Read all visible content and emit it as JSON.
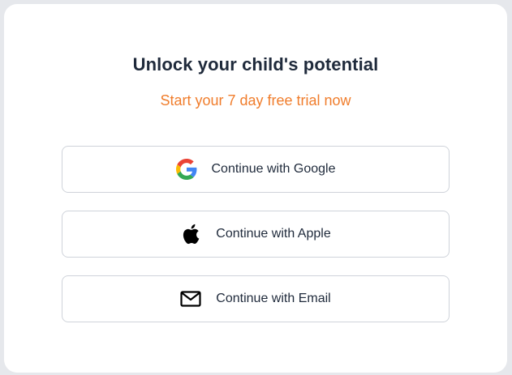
{
  "header": {
    "title": "Unlock your child's potential",
    "subtitle": "Start your 7 day free trial now"
  },
  "colors": {
    "subtitle": "#f07d2c",
    "title": "#1f2a3b",
    "border": "#cfd3da"
  },
  "buttons": [
    {
      "label": "Continue with Google",
      "icon": "google-icon"
    },
    {
      "label": "Continue with Apple",
      "icon": "apple-icon"
    },
    {
      "label": "Continue with Email",
      "icon": "email-icon"
    }
  ]
}
